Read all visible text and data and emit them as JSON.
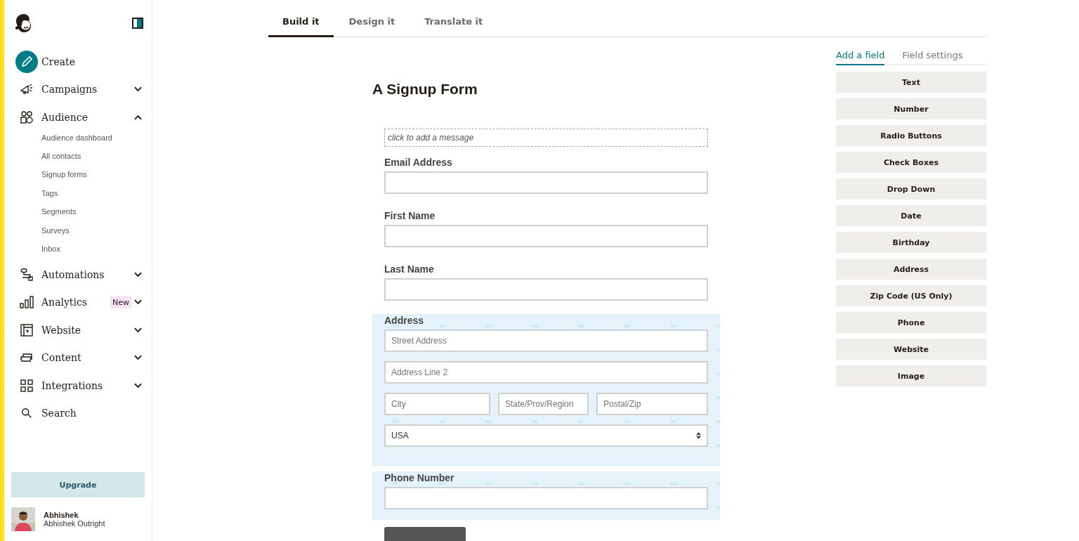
{
  "sidebar": {
    "items": [
      {
        "kind": "create",
        "label": "Create"
      },
      {
        "kind": "campaigns",
        "label": "Campaigns",
        "expanded": false
      },
      {
        "kind": "audience",
        "label": "Audience",
        "expanded": true,
        "children": [
          {
            "label": "Audience dashboard"
          },
          {
            "label": "All contacts"
          },
          {
            "label": "Signup forms"
          },
          {
            "label": "Tags"
          },
          {
            "label": "Segments"
          },
          {
            "label": "Surveys"
          },
          {
            "label": "Inbox"
          }
        ]
      },
      {
        "kind": "automations",
        "label": "Automations",
        "expanded": false
      },
      {
        "kind": "analytics",
        "label": "Analytics",
        "badge": "New",
        "expanded": false
      },
      {
        "kind": "website",
        "label": "Website",
        "expanded": false
      },
      {
        "kind": "content",
        "label": "Content",
        "expanded": false
      },
      {
        "kind": "integrations",
        "label": "Integrations",
        "expanded": false
      },
      {
        "kind": "search",
        "label": "Search"
      }
    ],
    "upgrade": "Upgrade",
    "user": {
      "name": "Abhishek",
      "account": "Abhishek Outright"
    }
  },
  "tabs": [
    {
      "label": "Build it",
      "selected": true
    },
    {
      "label": "Design it",
      "selected": false
    },
    {
      "label": "Translate it",
      "selected": false
    }
  ],
  "form": {
    "title": "A Signup Form",
    "message_placeholder": "click to add a message",
    "fields": [
      {
        "kind": "text",
        "label": "Email Address",
        "hidden": false
      },
      {
        "kind": "text",
        "label": "First Name",
        "hidden": false
      },
      {
        "kind": "text",
        "label": "Last Name",
        "hidden": false
      },
      {
        "kind": "address",
        "label": "Address",
        "hidden": true,
        "inputs": [
          {
            "placeholder": "Street Address"
          },
          {
            "placeholder": "Address Line 2"
          },
          {
            "placeholder": "City"
          },
          {
            "placeholder": "State/Prov/Region"
          },
          {
            "placeholder": "Postal/Zip"
          }
        ],
        "country": "USA"
      },
      {
        "kind": "text",
        "label": "Phone Number",
        "hidden": true
      }
    ]
  },
  "panel": {
    "tabs": [
      {
        "label": "Add a field",
        "selected": true
      },
      {
        "label": "Field settings",
        "selected": false
      }
    ],
    "buttons": [
      "Text",
      "Number",
      "Radio Buttons",
      "Check Boxes",
      "Drop Down",
      "Date",
      "Birthday",
      "Address",
      "Zip Code (US Only)",
      "Phone",
      "Website",
      "Image"
    ]
  }
}
